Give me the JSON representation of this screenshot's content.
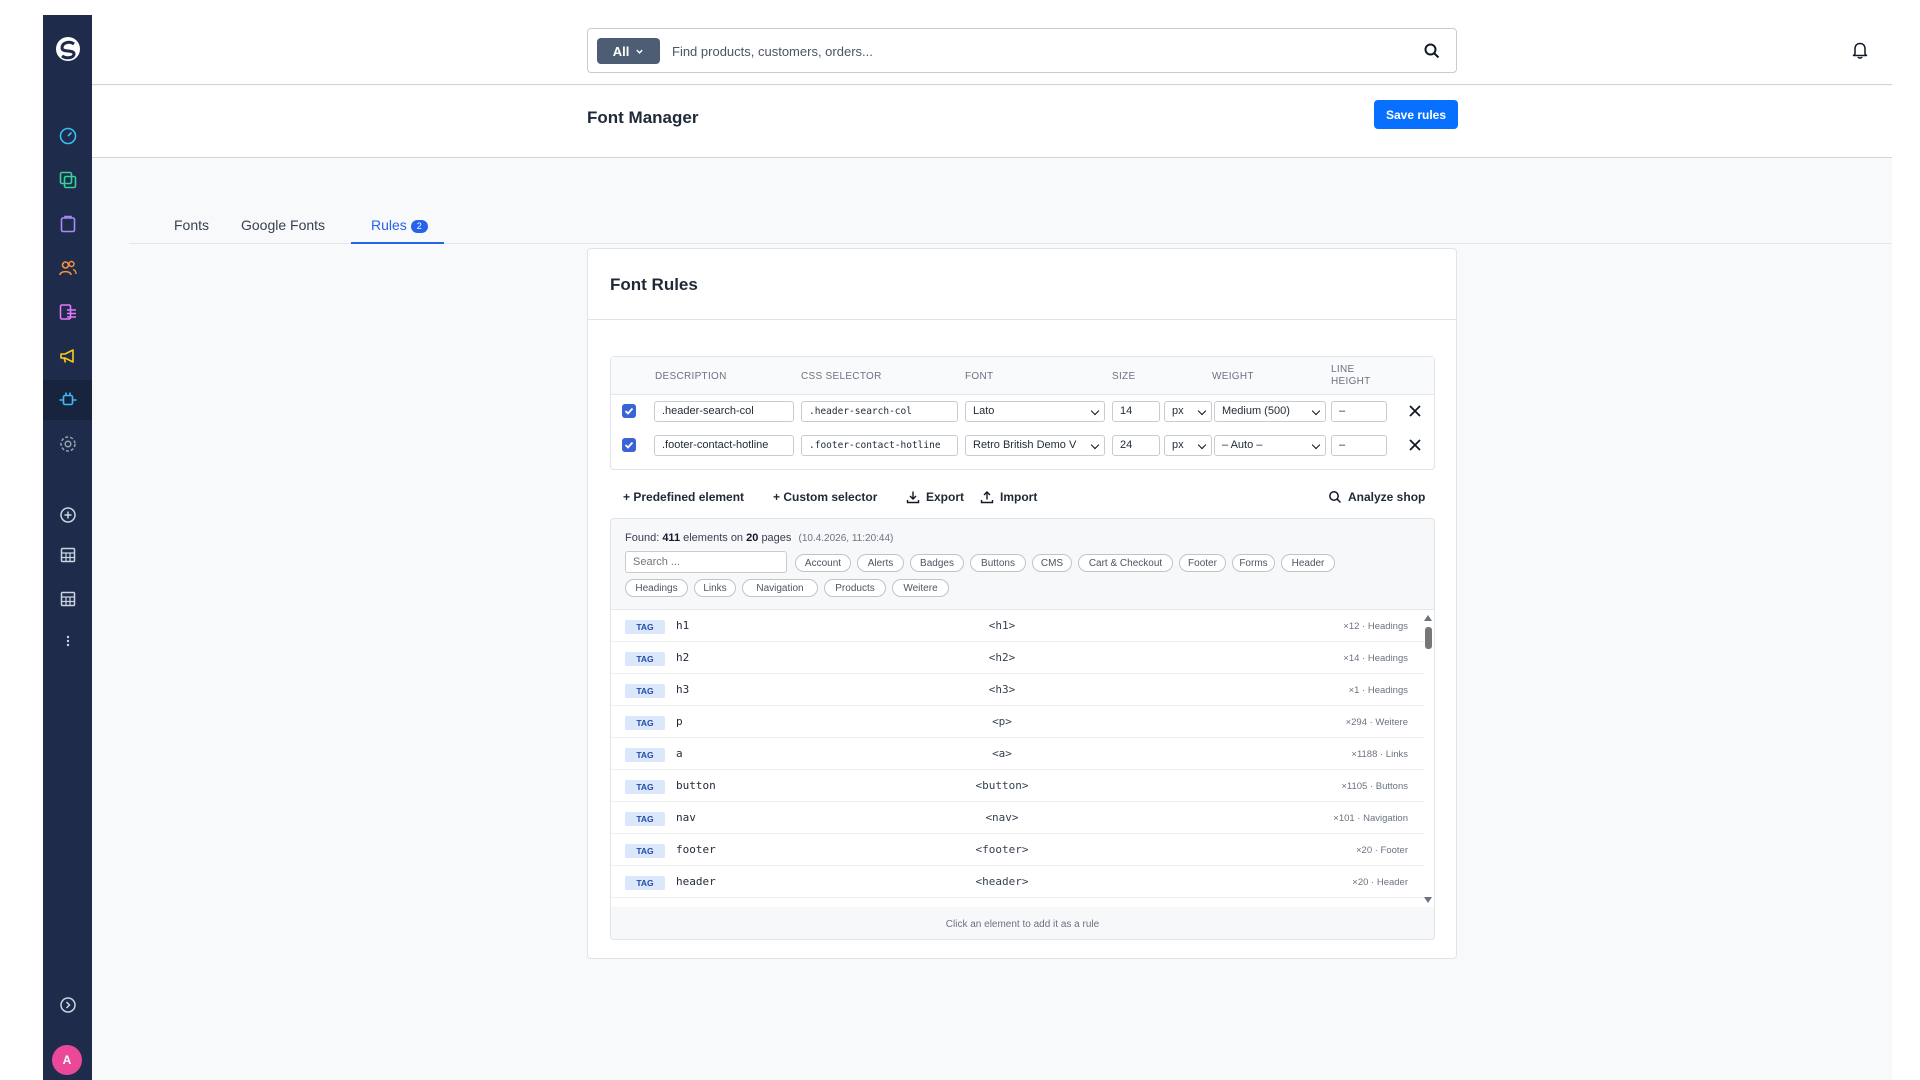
{
  "search": {
    "scope": "All",
    "placeholder": "Find products, customers, orders..."
  },
  "page": {
    "title": "Font Manager",
    "save_label": "Save rules"
  },
  "tabs": [
    {
      "label": "Fonts"
    },
    {
      "label": "Google Fonts"
    },
    {
      "label": "Rules",
      "badge": "2",
      "active": true
    }
  ],
  "card": {
    "title": "Font Rules"
  },
  "rules_table": {
    "headers": {
      "description": "DESCRIPTION",
      "selector": "CSS SELECTOR",
      "font": "FONT",
      "size": "SIZE",
      "weight": "WEIGHT",
      "line_height_1": "LINE",
      "line_height_2": "HEIGHT"
    },
    "rows": [
      {
        "checked": true,
        "description": ".header-search-col",
        "selector": ".header-search-col",
        "font": "Lato",
        "size": "14",
        "unit": "px",
        "weight": "Medium (500)",
        "line_height": "–"
      },
      {
        "checked": true,
        "description": ".footer-contact-hotline",
        "selector": ".footer-contact-hotline",
        "font": "Retro British Demo V",
        "size": "24",
        "unit": "px",
        "weight": "– Auto –",
        "line_height": "–"
      }
    ]
  },
  "actions": {
    "predefined": "+ Predefined element",
    "custom": "+ Custom selector",
    "export": "Export",
    "import": "Import",
    "analyze": "Analyze shop"
  },
  "found": {
    "prefix": "Found:",
    "count": "411",
    "mid": "elements on",
    "pages": "20",
    "suffix": "pages",
    "timestamp": "(10.4.2026, 11:20:44)",
    "search_placeholder": "Search ...",
    "chips": [
      "Account",
      "Alerts",
      "Badges",
      "Buttons",
      "CMS",
      "Cart & Checkout",
      "Footer",
      "Forms",
      "Header",
      "Headings",
      "Links",
      "Navigation",
      "Products",
      "Weitere"
    ],
    "badge_label": "TAG",
    "elements": [
      {
        "name": "h1",
        "tag": "<h1>",
        "meta": "×12 · Headings"
      },
      {
        "name": "h2",
        "tag": "<h2>",
        "meta": "×14 · Headings"
      },
      {
        "name": "h3",
        "tag": "<h3>",
        "meta": "×1 · Headings"
      },
      {
        "name": "p",
        "tag": "<p>",
        "meta": "×294 · Weitere"
      },
      {
        "name": "a",
        "tag": "<a>",
        "meta": "×1188 · Links"
      },
      {
        "name": "button",
        "tag": "<button>",
        "meta": "×1105 · Buttons"
      },
      {
        "name": "nav",
        "tag": "<nav>",
        "meta": "×101 · Navigation"
      },
      {
        "name": "footer",
        "tag": "<footer>",
        "meta": "×20 · Footer"
      },
      {
        "name": "header",
        "tag": "<header>",
        "meta": "×20 · Header"
      }
    ],
    "footer_hint": "Click an element to add it as a rule"
  },
  "user": {
    "avatar_initial": "A"
  },
  "colors": {
    "accent": "#0870ff",
    "sidebar": "#1e2b4a",
    "tab_active": "#2563eb",
    "avatar": "#ec4899"
  },
  "icons": [
    "logo-icon",
    "dashboard-icon",
    "catalog-icon",
    "orders-icon",
    "customers-icon",
    "content-icon",
    "marketing-icon",
    "extensions-icon",
    "settings-icon",
    "add-icon",
    "table-icon",
    "table-icon",
    "more-icon",
    "expand-icon",
    "search-icon",
    "bell-icon",
    "download-icon",
    "upload-icon",
    "close-icon"
  ]
}
